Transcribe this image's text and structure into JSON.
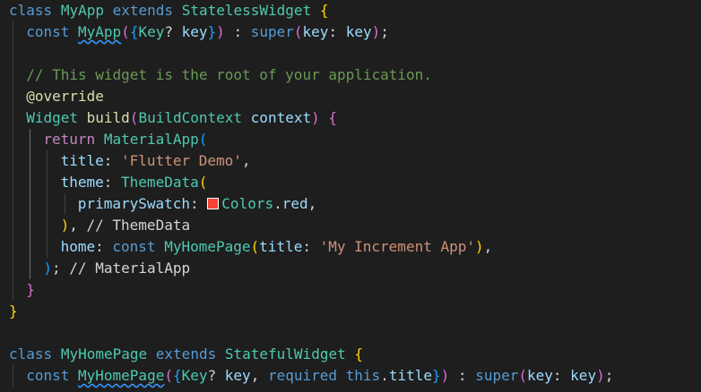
{
  "editor": {
    "swatch_color": "#f44336",
    "lines": [
      {
        "indent": 0,
        "tokens": [
          {
            "t": "class",
            "c": "kw"
          },
          {
            "t": " "
          },
          {
            "t": "MyApp",
            "c": "type"
          },
          {
            "t": " "
          },
          {
            "t": "extends",
            "c": "kw"
          },
          {
            "t": " "
          },
          {
            "t": "StatelessWidget",
            "c": "type"
          },
          {
            "t": " "
          },
          {
            "t": "{",
            "c": "brace1"
          }
        ]
      },
      {
        "indent": 1,
        "tokens": [
          {
            "t": "const",
            "c": "kw"
          },
          {
            "t": " "
          },
          {
            "t": "MyApp",
            "c": "type",
            "squiggle": true
          },
          {
            "t": "(",
            "c": "brace2"
          },
          {
            "t": "{",
            "c": "brace3"
          },
          {
            "t": "Key",
            "c": "type"
          },
          {
            "t": "? "
          },
          {
            "t": "key",
            "c": "var"
          },
          {
            "t": "}",
            "c": "brace3"
          },
          {
            "t": ")",
            "c": "brace2"
          },
          {
            "t": " : "
          },
          {
            "t": "super",
            "c": "kw"
          },
          {
            "t": "(",
            "c": "brace2"
          },
          {
            "t": "key",
            "c": "var"
          },
          {
            "t": ": "
          },
          {
            "t": "key",
            "c": "var"
          },
          {
            "t": ")",
            "c": "brace2"
          },
          {
            "t": ";"
          }
        ]
      },
      {
        "indent": 1,
        "tokens": []
      },
      {
        "indent": 1,
        "tokens": [
          {
            "t": "// This widget is the root of your application.",
            "c": "comment"
          }
        ]
      },
      {
        "indent": 1,
        "tokens": [
          {
            "t": "@override",
            "c": "fn"
          }
        ]
      },
      {
        "indent": 1,
        "tokens": [
          {
            "t": "Widget",
            "c": "type"
          },
          {
            "t": " "
          },
          {
            "t": "build",
            "c": "fn"
          },
          {
            "t": "(",
            "c": "brace2"
          },
          {
            "t": "BuildContext",
            "c": "type"
          },
          {
            "t": " "
          },
          {
            "t": "context",
            "c": "var"
          },
          {
            "t": ")",
            "c": "brace2"
          },
          {
            "t": " "
          },
          {
            "t": "{",
            "c": "brace2"
          }
        ]
      },
      {
        "indent": 2,
        "tokens": [
          {
            "t": "return",
            "c": "ctrl"
          },
          {
            "t": " "
          },
          {
            "t": "MaterialApp",
            "c": "type"
          },
          {
            "t": "(",
            "c": "brace3"
          }
        ]
      },
      {
        "indent": 3,
        "tokens": [
          {
            "t": "title",
            "c": "var"
          },
          {
            "t": ": "
          },
          {
            "t": "'Flutter Demo'",
            "c": "str"
          },
          {
            "t": ","
          }
        ]
      },
      {
        "indent": 3,
        "tokens": [
          {
            "t": "theme",
            "c": "var"
          },
          {
            "t": ": "
          },
          {
            "t": "ThemeData",
            "c": "type"
          },
          {
            "t": "(",
            "c": "brace1"
          }
        ]
      },
      {
        "indent": 4,
        "tokens": [
          {
            "t": "primarySwatch",
            "c": "var"
          },
          {
            "t": ": "
          },
          {
            "swatch": true
          },
          {
            "t": "Colors",
            "c": "type"
          },
          {
            "t": "."
          },
          {
            "t": "red",
            "c": "var"
          },
          {
            "t": ","
          }
        ]
      },
      {
        "indent": 3,
        "tokens": [
          {
            "t": ")",
            "c": "brace1"
          },
          {
            "t": ", "
          },
          {
            "t": "// ThemeData",
            "c": "punct"
          }
        ]
      },
      {
        "indent": 3,
        "tokens": [
          {
            "t": "home",
            "c": "var"
          },
          {
            "t": ": "
          },
          {
            "t": "const",
            "c": "kw"
          },
          {
            "t": " "
          },
          {
            "t": "MyHomePage",
            "c": "type"
          },
          {
            "t": "(",
            "c": "brace1"
          },
          {
            "t": "title",
            "c": "var"
          },
          {
            "t": ": "
          },
          {
            "t": "'My Increment App'",
            "c": "str"
          },
          {
            "t": ")",
            "c": "brace1"
          },
          {
            "t": ","
          }
        ]
      },
      {
        "indent": 2,
        "tokens": [
          {
            "t": ")",
            "c": "brace3"
          },
          {
            "t": "; "
          },
          {
            "t": "// MaterialApp",
            "c": "punct"
          }
        ]
      },
      {
        "indent": 1,
        "tokens": [
          {
            "t": "}",
            "c": "brace2"
          }
        ]
      },
      {
        "indent": 0,
        "tokens": [
          {
            "t": "}",
            "c": "brace1"
          }
        ]
      },
      {
        "indent": 0,
        "tokens": []
      },
      {
        "indent": 0,
        "tokens": [
          {
            "t": "class",
            "c": "kw"
          },
          {
            "t": " "
          },
          {
            "t": "MyHomePage",
            "c": "type"
          },
          {
            "t": " "
          },
          {
            "t": "extends",
            "c": "kw"
          },
          {
            "t": " "
          },
          {
            "t": "StatefulWidget",
            "c": "type"
          },
          {
            "t": " "
          },
          {
            "t": "{",
            "c": "brace1"
          }
        ]
      },
      {
        "indent": 1,
        "tokens": [
          {
            "t": "const",
            "c": "kw"
          },
          {
            "t": " "
          },
          {
            "t": "MyHomePage",
            "c": "type",
            "squiggle": true
          },
          {
            "t": "(",
            "c": "brace2"
          },
          {
            "t": "{",
            "c": "brace3"
          },
          {
            "t": "Key",
            "c": "type"
          },
          {
            "t": "? "
          },
          {
            "t": "key",
            "c": "var"
          },
          {
            "t": ", "
          },
          {
            "t": "required",
            "c": "kw"
          },
          {
            "t": " "
          },
          {
            "t": "this",
            "c": "kw"
          },
          {
            "t": "."
          },
          {
            "t": "title",
            "c": "var"
          },
          {
            "t": "}",
            "c": "brace3"
          },
          {
            "t": ")",
            "c": "brace2"
          },
          {
            "t": " : "
          },
          {
            "t": "super",
            "c": "kw"
          },
          {
            "t": "(",
            "c": "brace2"
          },
          {
            "t": "key",
            "c": "var"
          },
          {
            "t": ": "
          },
          {
            "t": "key",
            "c": "var"
          },
          {
            "t": ")",
            "c": "brace2"
          },
          {
            "t": ";"
          }
        ]
      }
    ]
  }
}
